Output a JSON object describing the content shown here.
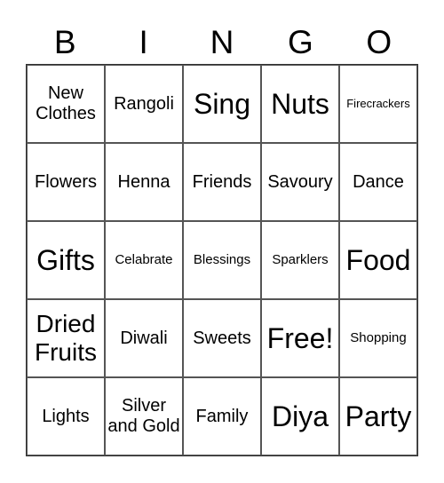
{
  "header": [
    "B",
    "I",
    "N",
    "G",
    "O"
  ],
  "cells": [
    {
      "text": "New Clothes",
      "size": "m"
    },
    {
      "text": "Rangoli",
      "size": "m"
    },
    {
      "text": "Sing",
      "size": "l"
    },
    {
      "text": "Nuts",
      "size": "l"
    },
    {
      "text": "Firecrackers",
      "size": "xs"
    },
    {
      "text": "Flowers",
      "size": "m"
    },
    {
      "text": "Henna",
      "size": "m"
    },
    {
      "text": "Friends",
      "size": "m"
    },
    {
      "text": "Savoury",
      "size": "m"
    },
    {
      "text": "Dance",
      "size": "m"
    },
    {
      "text": "Gifts",
      "size": "l"
    },
    {
      "text": "Celabrate",
      "size": "s"
    },
    {
      "text": "Blessings",
      "size": "s"
    },
    {
      "text": "Sparklers",
      "size": "s"
    },
    {
      "text": "Food",
      "size": "l"
    },
    {
      "text": "Dried Fruits",
      "size": "l"
    },
    {
      "text": "Diwali",
      "size": "m"
    },
    {
      "text": "Sweets",
      "size": "m"
    },
    {
      "text": "Free!",
      "size": "l"
    },
    {
      "text": "Shopping",
      "size": "s"
    },
    {
      "text": "Lights",
      "size": "m"
    },
    {
      "text": "Silver and Gold",
      "size": "m"
    },
    {
      "text": "Family",
      "size": "m"
    },
    {
      "text": "Diya",
      "size": "l"
    },
    {
      "text": "Party",
      "size": "l"
    }
  ]
}
